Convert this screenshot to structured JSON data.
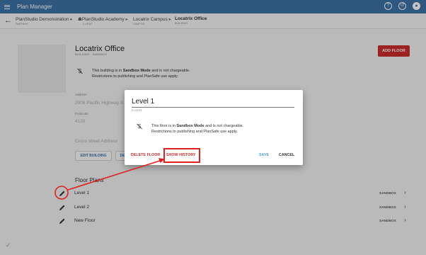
{
  "app": {
    "title": "Plan Manager"
  },
  "header_icons": [
    "help-icon",
    "history-icon",
    "account-icon"
  ],
  "breadcrumb": {
    "back_icon": "arrow-back-icon",
    "items": [
      {
        "name": "PlanStudio Demonstration",
        "type": "PARTNER"
      },
      {
        "name": "PlanStudio Academy",
        "type": "CLIENT"
      },
      {
        "name": "Locatrix Campus",
        "type": "CAMPUS"
      },
      {
        "name": "Locatrix Office",
        "type": "BUILDING"
      }
    ]
  },
  "building": {
    "name": "Locatrix Office",
    "subtitle": "BUILDING - SANDBOX",
    "add_floor_label": "ADD FLOOR",
    "sandbox_note_line1_pre": "This building is in ",
    "sandbox_note_mode": "Sandbox Mode",
    "sandbox_note_line1_post": " and is not chargeable.",
    "sandbox_note_line2": "Restrictions to publishing and PlanSafe use apply.",
    "address_label": "Address",
    "address_value": "2908 Pacific Highway S",
    "postcode_label": "Postcode",
    "postcode_value": "4129",
    "cross_street_label": "Cross street Address",
    "edit_building_label": "EDIT BUILDING",
    "second_button_label": "DE"
  },
  "floor_plans": {
    "title": "Floor Plans",
    "rows": [
      {
        "name": "Level 1",
        "status": "SANDBOX"
      },
      {
        "name": "Level 2",
        "status": "SANDBOX"
      },
      {
        "name": "New Floor",
        "status": "SANDBOX"
      }
    ]
  },
  "dialog": {
    "floor_name_value": "Level 1",
    "floor_name_label": "FLOOR",
    "note_line1_pre": "This floor is in ",
    "note_mode": "Sandbox Mode",
    "note_line1_post": " and is not chargeable.",
    "note_line2": "Restrictions to publishing and PlanSafe use apply.",
    "delete_label": "DELETE FLOOR",
    "history_label": "SHOW HISTORY",
    "save_label": "SAVE",
    "cancel_label": "CANCEL"
  },
  "colors": {
    "appbar": "#3d73a6",
    "danger": "#cc2b2b",
    "annotation": "#e02020",
    "save": "#5a9fd4"
  }
}
